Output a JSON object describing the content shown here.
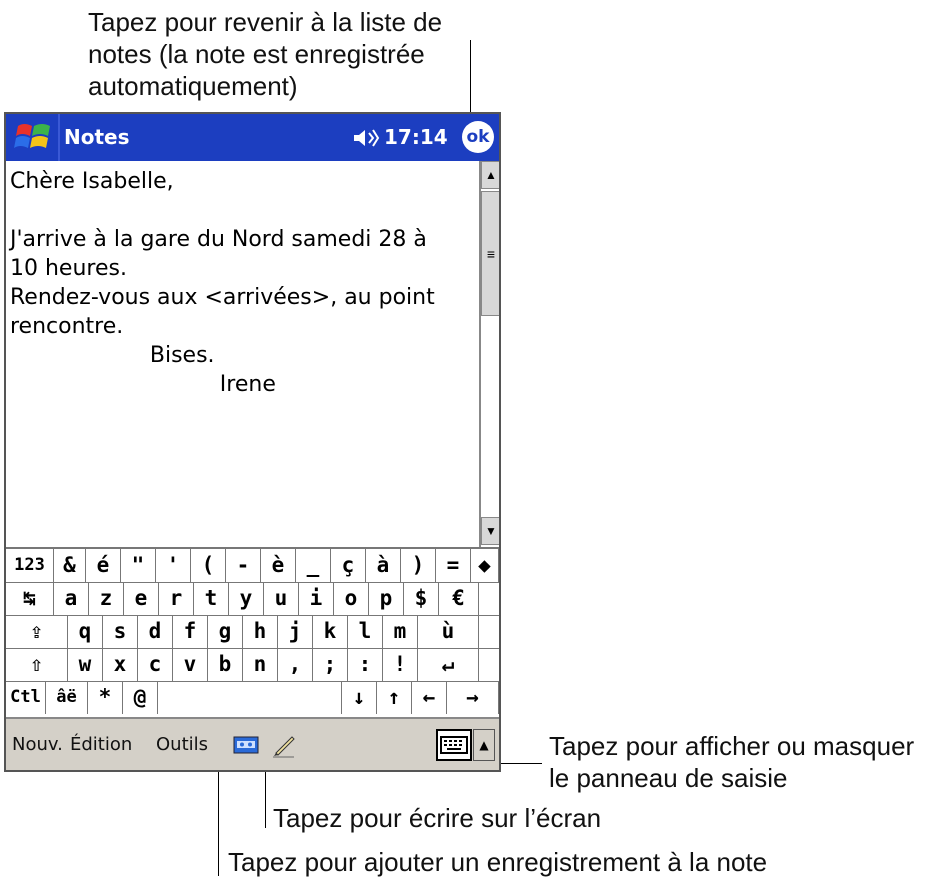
{
  "callouts": {
    "ok_top": [
      "Tapez pour revenir à la liste de",
      "notes (la note est enregistrée",
      "automatiquement)"
    ],
    "sip_right": [
      "Tapez pour afficher ou masquer",
      "le panneau de saisie"
    ],
    "pen": "Tapez pour écrire sur l’écran",
    "recording": "Tapez pour ajouter un enregistrement à la note"
  },
  "titlebar": {
    "app_title": "Notes",
    "time": "17:14",
    "ok_label": "ok",
    "start_icon": "windows-flag-icon",
    "sound_icon": "speaker-icon"
  },
  "note": {
    "lines": [
      "Chère Isabelle,",
      "",
      "J'arrive à la gare du Nord samedi 28 à",
      "10 heures.",
      "Rendez-vous aux <arrivées>, au point",
      "rencontre.",
      "                    Bises.",
      "                              Irene"
    ]
  },
  "keyboard": {
    "row1": [
      "123",
      "&",
      "é",
      "\"",
      "'",
      "(",
      "-",
      "è",
      "_",
      "ç",
      "à",
      ")",
      "=",
      "◆"
    ],
    "row2": [
      "↹",
      "a",
      "z",
      "e",
      "r",
      "t",
      "y",
      "u",
      "i",
      "o",
      "p",
      "$",
      "€"
    ],
    "row3": [
      "⇪",
      "q",
      "s",
      "d",
      "f",
      "g",
      "h",
      "j",
      "k",
      "l",
      "m",
      "ù"
    ],
    "row4": [
      "⇧",
      "w",
      "x",
      "c",
      "v",
      "b",
      "n",
      ",",
      ";",
      ":",
      "!",
      "↵"
    ],
    "row5": [
      "Ctl",
      "âë",
      "*",
      "@",
      "",
      "↓",
      "↑",
      "←",
      "→"
    ]
  },
  "menubar": {
    "items": [
      "Nouv.",
      "Édition",
      "Outils"
    ],
    "recorder_icon": "cassette-icon",
    "pen_icon": "pen-icon",
    "keyboard_icon": "keyboard-icon"
  },
  "colors": {
    "titlebar": "#1c3ec0",
    "menubar": "#d4d0c8"
  }
}
